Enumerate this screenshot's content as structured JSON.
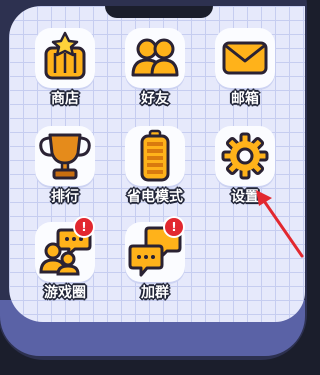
{
  "apps": [
    {
      "label": "商店",
      "icon": "shop-icon"
    },
    {
      "label": "好友",
      "icon": "friends-icon"
    },
    {
      "label": "邮箱",
      "icon": "mail-icon"
    },
    {
      "label": "排行",
      "icon": "trophy-icon"
    },
    {
      "label": "省电模式",
      "icon": "battery-icon"
    },
    {
      "label": "设置",
      "icon": "gear-icon"
    },
    {
      "label": "游戏圈",
      "icon": "game-circle-icon",
      "badge": "!"
    },
    {
      "label": "加群",
      "icon": "chat-bubbles-icon",
      "badge": "!"
    }
  ],
  "colors": {
    "icon_fill": "#ffb21a",
    "icon_outline": "#2a2233",
    "badge": "#e2282f",
    "annotation_arrow": "#e2282f"
  }
}
